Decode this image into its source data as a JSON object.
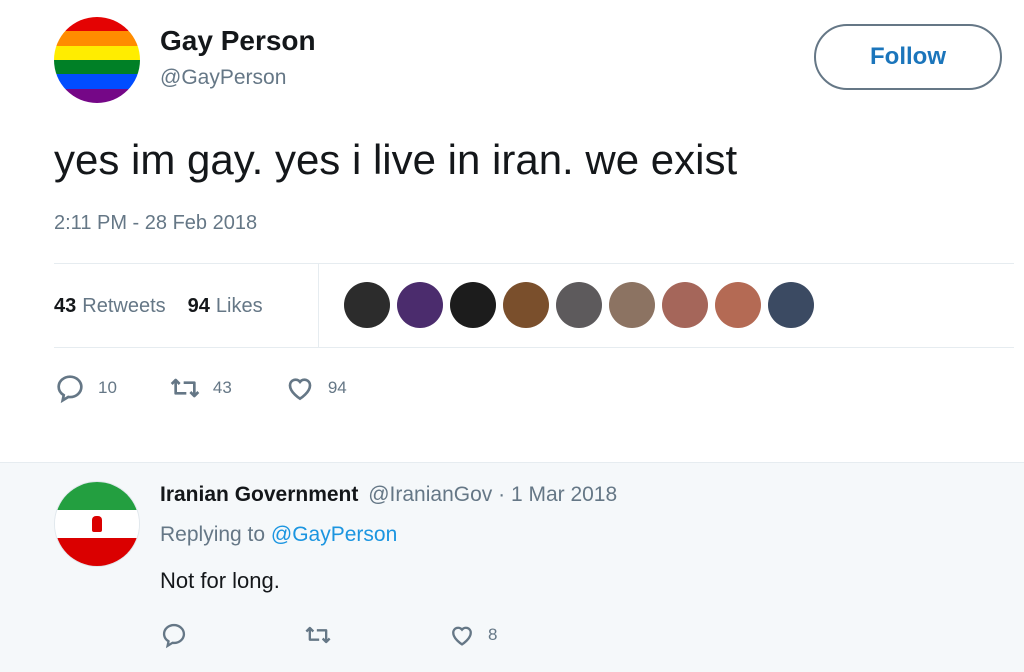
{
  "tweet": {
    "display_name": "Gay Person",
    "handle": "@GayPerson",
    "follow_label": "Follow",
    "text": "yes im gay. yes i live in iran. we exist",
    "timestamp": "2:11 PM - 28 Feb 2018",
    "retweets_count": "43",
    "retweets_label": "Retweets",
    "likes_count": "94",
    "likes_label": "Likes",
    "actions": {
      "replies": "10",
      "retweets": "43",
      "likes": "94"
    },
    "avatar_icon": "rainbow-flag-icon",
    "avatar_colors": [
      "#e40303",
      "#ff8c00",
      "#ffed00",
      "#008026",
      "#004dff",
      "#750787"
    ],
    "liker_face_colors": [
      "#2c2c2c",
      "#4b2c6d",
      "#1c1c1c",
      "#7a4f2c",
      "#5d5a5c",
      "#8c7362",
      "#a5665a",
      "#b46a54",
      "#3b4a62"
    ]
  },
  "reply": {
    "display_name": "Iranian Government",
    "meta": "@IranianGov · 1 Mar 2018",
    "replying_prefix": "Replying to",
    "replying_handle": "@GayPerson",
    "text": "Not for long.",
    "likes": "8",
    "avatar_icon": "iran-flag-icon"
  },
  "colors": {
    "accent": "#1b95e0",
    "secondary_text": "#657786",
    "primary_text": "#14171a"
  }
}
